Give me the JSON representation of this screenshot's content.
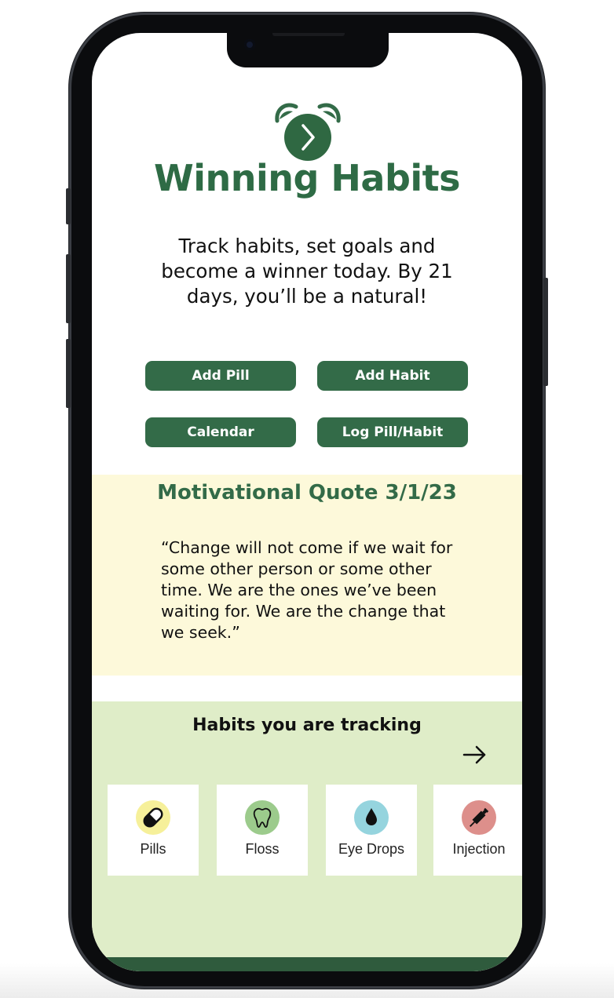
{
  "app": {
    "title": "Winning Habits",
    "tagline": "Track habits, set goals and become a winner today. By 21 days, you’ll be a natural!"
  },
  "actions": {
    "add_pill": "Add Pill",
    "add_habit": "Add Habit",
    "calendar": "Calendar",
    "log": "Log Pill/Habit"
  },
  "quote": {
    "title": "Motivational Quote 3/1/23",
    "text": "“Change will not come if we wait for some other person or some other time. We are the ones we’ve been waiting for. We are the change that we seek.”"
  },
  "habits": {
    "title": "Habits you are tracking",
    "next_icon": "arrow-right-icon",
    "items": [
      {
        "label": "Pills",
        "icon": "pill-icon",
        "color": "#f6f09a"
      },
      {
        "label": "Floss",
        "icon": "tooth-icon",
        "color": "#9ccb8c"
      },
      {
        "label": "Eye Drops",
        "icon": "drop-icon",
        "color": "#95d4de"
      },
      {
        "label": "Injection",
        "icon": "syringe-icon",
        "color": "#dd8f8b"
      }
    ]
  },
  "colors": {
    "brand_green": "#336b48",
    "quote_bg": "#fdf9da",
    "habits_bg": "#dfedc8"
  }
}
